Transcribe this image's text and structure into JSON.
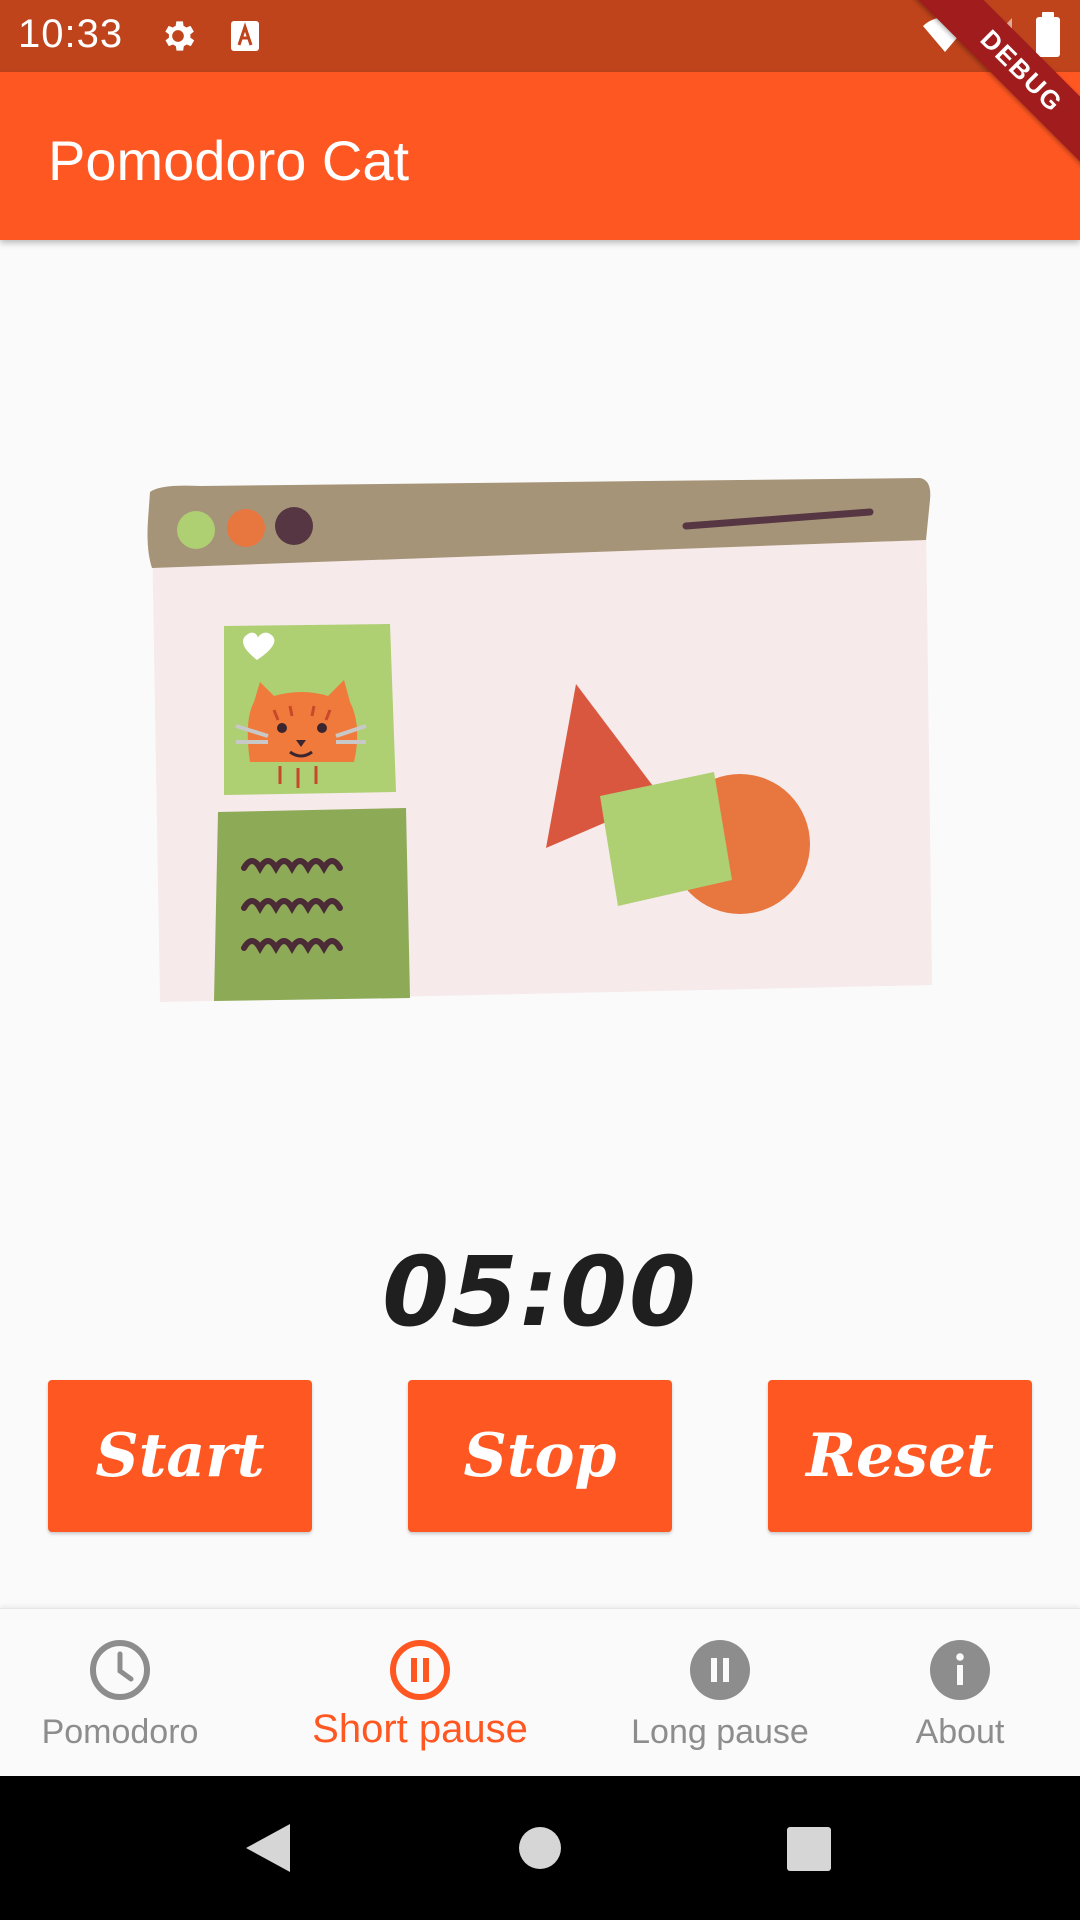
{
  "status_bar": {
    "time": "10:33",
    "icons": [
      "settings-gear",
      "text-a-box",
      "wifi",
      "cellular",
      "battery"
    ]
  },
  "debug_banner": "DEBUG",
  "app_bar": {
    "title": "Pomodoro Cat"
  },
  "timer": {
    "display": "05:00"
  },
  "controls": {
    "start_label": "Start",
    "stop_label": "Stop",
    "reset_label": "Reset"
  },
  "bottom_nav": {
    "selected": "Short pause",
    "items": [
      {
        "label": "Pomodoro",
        "icon": "clock-icon",
        "active": false
      },
      {
        "label": "Short pause",
        "icon": "pause-circle-outline-icon",
        "active": true
      },
      {
        "label": "Long pause",
        "icon": "pause-circle-filled-icon",
        "active": false
      },
      {
        "label": "About",
        "icon": "info-icon",
        "active": false
      }
    ]
  },
  "colors": {
    "primary": "#ff5722",
    "status_bar": "#bf441c",
    "inactive": "#8d8d8d",
    "timer_text": "#1f1f1f"
  }
}
